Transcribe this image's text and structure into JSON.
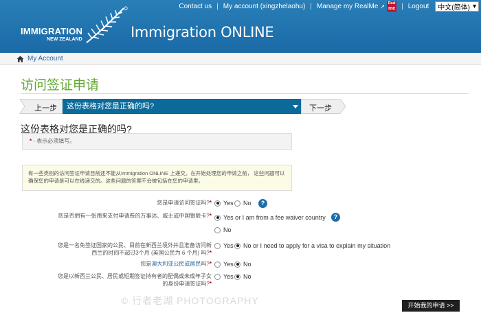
{
  "brand": {
    "line1": "IMMIGRATION",
    "line2": "NEW ZEALAND",
    "app_title": "Immigration ONLINE"
  },
  "topnav": {
    "contact": "Contact us",
    "account": "My account (xingzhelaohu)",
    "realme": "Manage my RealMe",
    "realme_badge_top": "Real",
    "realme_badge_bottom": "me",
    "logout": "Logout",
    "language": "中文(简体)",
    "separator": "|"
  },
  "breadcrumb": {
    "item": "My Account"
  },
  "page": {
    "heading": "访问签证申请",
    "steps": {
      "prev": "上一步",
      "current": "这份表格对您是正确的吗?",
      "next": "下一步"
    },
    "form_title": "这份表格对您是正确的吗?",
    "required_star": "*",
    "required_note": " - 表示必须填写。",
    "notice": "有一些类别的访问签证申请目前还不能从Immigration ONLINE 上递交。在开始处理您的申请之前， 这些问题可以确保您的申请是可以在线递交的。这些问题的答案不会被包括在您的申请里。"
  },
  "questions": [
    {
      "label": "您是申请访问签证吗?",
      "req": "*",
      "options": [
        {
          "text": "Yes",
          "selected": true
        },
        {
          "text": "No",
          "selected": false
        }
      ],
      "help": "?"
    },
    {
      "label": "您是否拥有一张用来支付申请费的万事达、威士或中国银联卡?",
      "req": "*",
      "options": [
        {
          "text": "Yes or I am from a fee waiver country",
          "selected": true
        },
        {
          "text": "No",
          "selected": false
        }
      ],
      "help": "?"
    },
    {
      "label": "您是一名免签证国家的公民、目前在新西兰境外并且准备访问新西兰的时间不超过3个月 (英国公民为 6 个月) 吗?",
      "req": "*",
      "options": [
        {
          "text": "Yes",
          "selected": false
        },
        {
          "text": "No or I need to apply for a visa to explain my situation",
          "selected": true
        }
      ]
    },
    {
      "label_pre": "您是",
      "label_link": "澳大利亚公民或居民",
      "label_post": "吗?",
      "req": "*",
      "options": [
        {
          "text": "Yes",
          "selected": false
        },
        {
          "text": "No",
          "selected": true
        }
      ]
    },
    {
      "label": "您是以新西兰公民、居民或短期签证持有者的配偶或未成年子女的身份申请签证吗?",
      "req": "*",
      "options": [
        {
          "text": "Yes",
          "selected": false
        },
        {
          "text": "No",
          "selected": true
        }
      ]
    }
  ],
  "actions": {
    "start": "开始我的申请 >>"
  },
  "watermark": "© 行者老湖 PHOTOGRAPHY",
  "colors": {
    "header": "#1a6aa6",
    "heading_green": "#5fa82e",
    "step_active": "#0c6a9a",
    "required": "#cc0000"
  }
}
